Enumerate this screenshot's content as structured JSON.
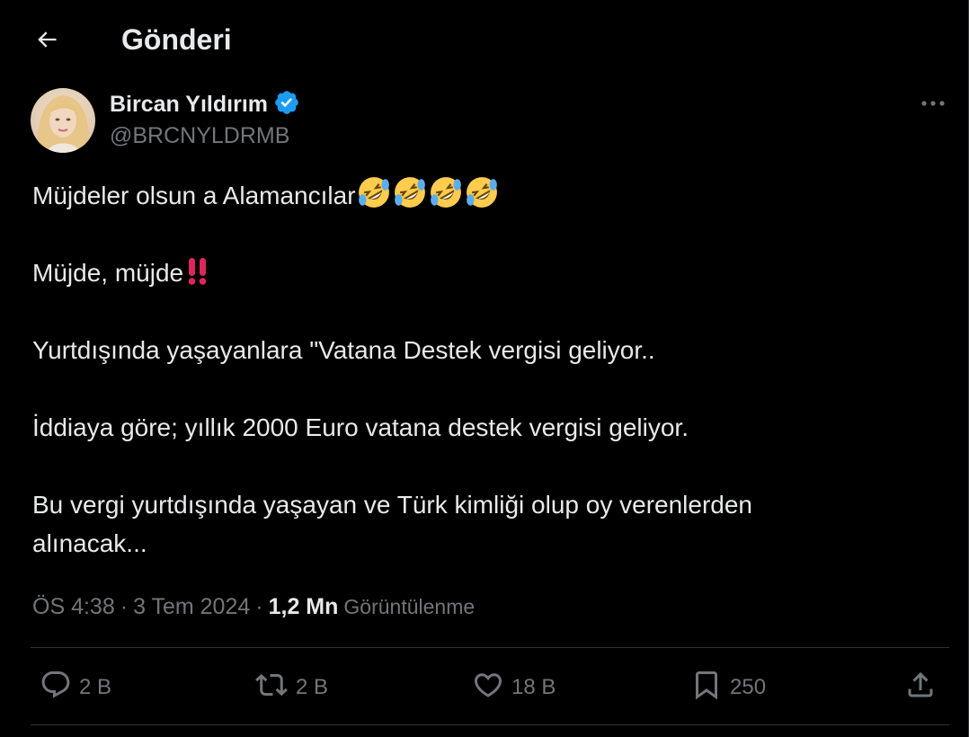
{
  "header": {
    "title": "Gönderi",
    "back_icon": "arrow-left-icon"
  },
  "author": {
    "name": "Bircan Yıldırım",
    "handle": "@BRCNYLDRMB",
    "verified_color": "#1d9bf0"
  },
  "tweet": {
    "line1": "Müjdeler olsun a Alamancılar",
    "line2": "Müjde, müjde",
    "line3": "Yurtdışında yaşayanlara \"Vatana Destek vergisi geliyor..",
    "line4": "İddiaya göre; yıllık 2000 Euro vatana destek vergisi geliyor.",
    "line5a": "Bu vergi yurtdışında yaşayan ve Türk kimliği olup oy verenlerden",
    "line5b": "alınacak..."
  },
  "meta": {
    "time": "ÖS 4:38",
    "date": "3 Tem 2024",
    "views_count": "1,2 Mn",
    "views_label": "Görüntülenme"
  },
  "actions": {
    "replies": "2 B",
    "reposts": "2 B",
    "likes": "18 B",
    "bookmarks": "250"
  },
  "colors": {
    "background": "#000000",
    "text": "#e7e9ea",
    "secondary": "#71767b",
    "divider": "#2f3336",
    "accent": "#1d9bf0",
    "double_exclamation": "#e0245e"
  }
}
